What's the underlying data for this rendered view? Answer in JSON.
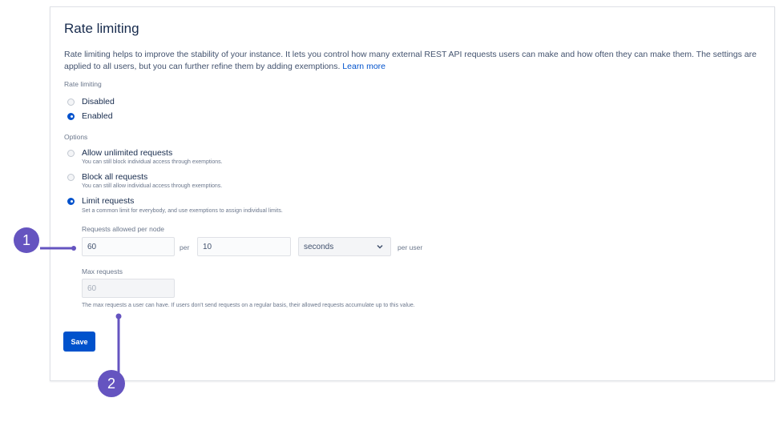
{
  "page": {
    "title": "Rate limiting",
    "description": "Rate limiting helps to improve the stability of your instance. It lets you control how many external REST API requests users can make and how often they can make them. The settings are applied to all users, but you can further refine them by adding exemptions.",
    "learn_more": "Learn more"
  },
  "rate_limiting": {
    "label": "Rate limiting",
    "options": [
      {
        "label": "Disabled",
        "checked": false
      },
      {
        "label": "Enabled",
        "checked": true
      }
    ]
  },
  "options": {
    "label": "Options",
    "items": [
      {
        "label": "Allow unlimited requests",
        "hint": "You can still block individual access through exemptions.",
        "checked": false
      },
      {
        "label": "Block all requests",
        "hint": "You can still allow individual access through exemptions.",
        "checked": false
      },
      {
        "label": "Limit requests",
        "hint": "Set a common limit for everybody, and use exemptions to assign individual limits.",
        "checked": true
      }
    ]
  },
  "limits": {
    "requests_label": "Requests allowed per node",
    "requests_value": "60",
    "per_label": "per",
    "interval_value": "10",
    "unit_value": "seconds",
    "per_user_label": "per user",
    "max_label": "Max requests",
    "max_value": "60",
    "max_hint": "The max requests a user can have. If users don't send requests on a regular basis, their allowed requests accumulate up to this value."
  },
  "actions": {
    "save_label": "Save"
  },
  "callouts": {
    "one": "1",
    "two": "2",
    "color": "#6554c0"
  },
  "colors": {
    "accent": "#0052cc"
  }
}
